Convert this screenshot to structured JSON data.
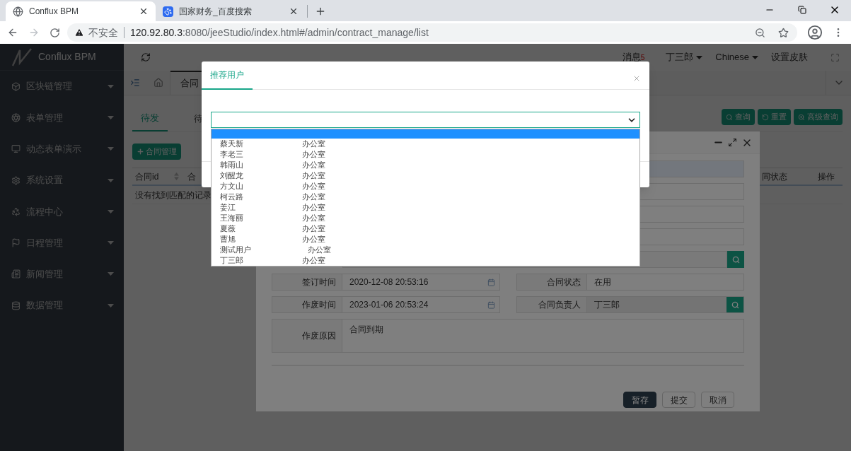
{
  "browser": {
    "tabs": [
      {
        "title": "Conflux BPM",
        "selected": true,
        "kind": "globe"
      },
      {
        "title": "国家财务_百度搜索",
        "selected": false,
        "kind": "paw"
      }
    ],
    "security": "不安全",
    "url_host": "120.92.80.3",
    "url_rest": ":8080/jeeStudio/index.html#/admin/contract_manage/list"
  },
  "app": {
    "logo": "Conflux BPM",
    "header": {
      "messages": "消息",
      "message_count": "5",
      "user": "丁三郎",
      "language": "Chinese",
      "skin": "设置皮肤"
    },
    "sidebar": [
      {
        "label": "区块链管理"
      },
      {
        "label": "表单管理"
      },
      {
        "label": "动态表单演示"
      },
      {
        "label": "系统设置"
      },
      {
        "label": "流程中心"
      },
      {
        "label": "日程管理"
      },
      {
        "label": "新闻管理"
      },
      {
        "label": "数据管理"
      }
    ],
    "page_tab": "合同",
    "sub_tabs": [
      {
        "label": "待发",
        "selected": true
      },
      {
        "label": "待",
        "selected": false
      }
    ],
    "search_buttons": [
      {
        "label": "查询",
        "kind": "search"
      },
      {
        "label": "重置",
        "kind": "reset"
      },
      {
        "label": "高级查询",
        "kind": "advanced"
      }
    ],
    "add_button": "合同管理",
    "table": {
      "columns": [
        "合同id",
        "合",
        "同状态",
        "操作"
      ],
      "empty_message": "没有找到匹配的记录"
    }
  },
  "form_dialog": {
    "fields": [
      {
        "label": "签订时间",
        "value": "2020-12-08 20:53:16",
        "kind": "date"
      },
      {
        "label": "合同状态",
        "value": "在用",
        "kind": "text"
      },
      {
        "label": "作废时间",
        "value": "2023-01-06 20:53:24",
        "kind": "date"
      },
      {
        "label": "合同负责人",
        "value": "丁三郎",
        "kind": "lookup"
      }
    ],
    "reason": {
      "label": "作废原因",
      "value": "合同到期"
    },
    "buttons": [
      {
        "label": "暂存",
        "kind": "primary"
      },
      {
        "label": "提交",
        "kind": "default"
      },
      {
        "label": "取消",
        "kind": "default"
      }
    ]
  },
  "user_dialog": {
    "title": "推荐用户",
    "blank_option": {
      "selected": true
    },
    "options": [
      {
        "name": "蔡天新",
        "dept": "办公室",
        "selected": false
      },
      {
        "name": "李老三",
        "dept": "办公室",
        "selected": false
      },
      {
        "name": "韩雨山",
        "dept": "办公室",
        "selected": false
      },
      {
        "name": "刘醒龙",
        "dept": "办公室",
        "selected": false
      },
      {
        "name": "方文山",
        "dept": "办公室",
        "selected": false
      },
      {
        "name": "柯云路",
        "dept": "办公室",
        "selected": false
      },
      {
        "name": "姜江",
        "dept": "办公室",
        "selected": false
      },
      {
        "name": "王海丽",
        "dept": "办公室",
        "selected": false
      },
      {
        "name": "夏薇",
        "dept": "办公室",
        "selected": false
      },
      {
        "name": "曹旭",
        "dept": "办公室",
        "selected": false
      },
      {
        "name": "测试用户",
        "dept": "办公室",
        "selected": false
      },
      {
        "name": "丁三郎",
        "dept": "办公室",
        "selected": false
      }
    ]
  }
}
